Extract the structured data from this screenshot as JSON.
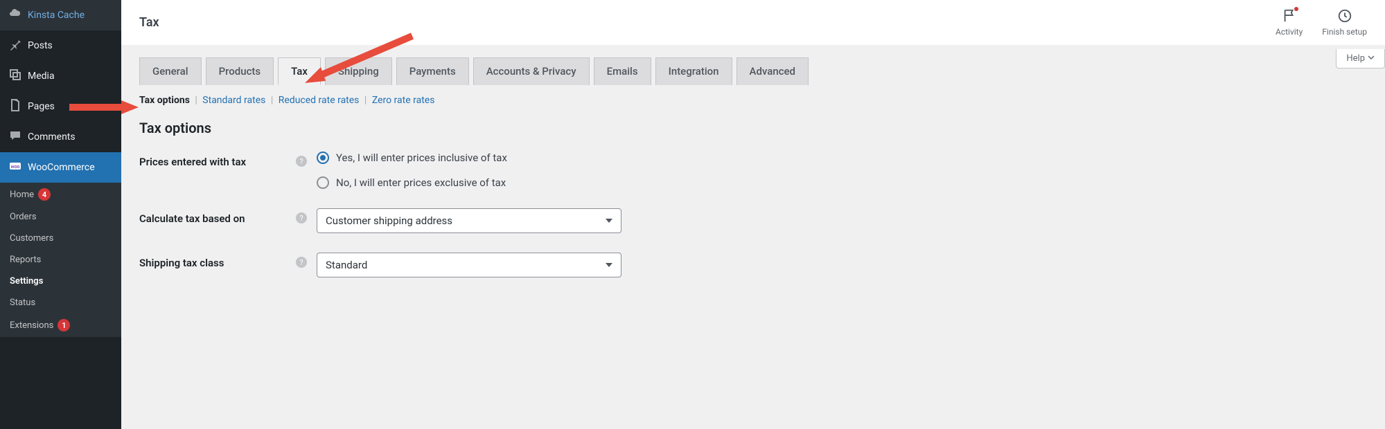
{
  "sidebar": {
    "items": [
      {
        "label": "Kinsta Cache",
        "icon": "cloud"
      },
      {
        "label": "Posts",
        "icon": "pin"
      },
      {
        "label": "Media",
        "icon": "media"
      },
      {
        "label": "Pages",
        "icon": "page"
      },
      {
        "label": "Comments",
        "icon": "comment"
      },
      {
        "label": "WooCommerce",
        "icon": "woo",
        "current": true
      }
    ],
    "submenu": [
      {
        "label": "Home",
        "badge": "4"
      },
      {
        "label": "Orders"
      },
      {
        "label": "Customers"
      },
      {
        "label": "Reports"
      },
      {
        "label": "Settings",
        "current": true
      },
      {
        "label": "Status"
      },
      {
        "label": "Extensions",
        "badge": "1"
      }
    ]
  },
  "topbar": {
    "title": "Tax",
    "activity_label": "Activity",
    "finish_label": "Finish setup"
  },
  "help_label": "Help",
  "tabs": [
    {
      "label": "General"
    },
    {
      "label": "Products"
    },
    {
      "label": "Tax",
      "active": true
    },
    {
      "label": "Shipping"
    },
    {
      "label": "Payments"
    },
    {
      "label": "Accounts & Privacy"
    },
    {
      "label": "Emails"
    },
    {
      "label": "Integration"
    },
    {
      "label": "Advanced"
    }
  ],
  "subtabs": {
    "current": "Tax options",
    "links": [
      "Standard rates",
      "Reduced rate rates",
      "Zero rate rates"
    ]
  },
  "section_heading": "Tax options",
  "fields": {
    "prices_with_tax": {
      "label": "Prices entered with tax",
      "option_inclusive": "Yes, I will enter prices inclusive of tax",
      "option_exclusive": "No, I will enter prices exclusive of tax",
      "selected": "inclusive"
    },
    "calculate_based_on": {
      "label": "Calculate tax based on",
      "value": "Customer shipping address"
    },
    "shipping_tax_class": {
      "label": "Shipping tax class",
      "value": "Standard"
    }
  }
}
